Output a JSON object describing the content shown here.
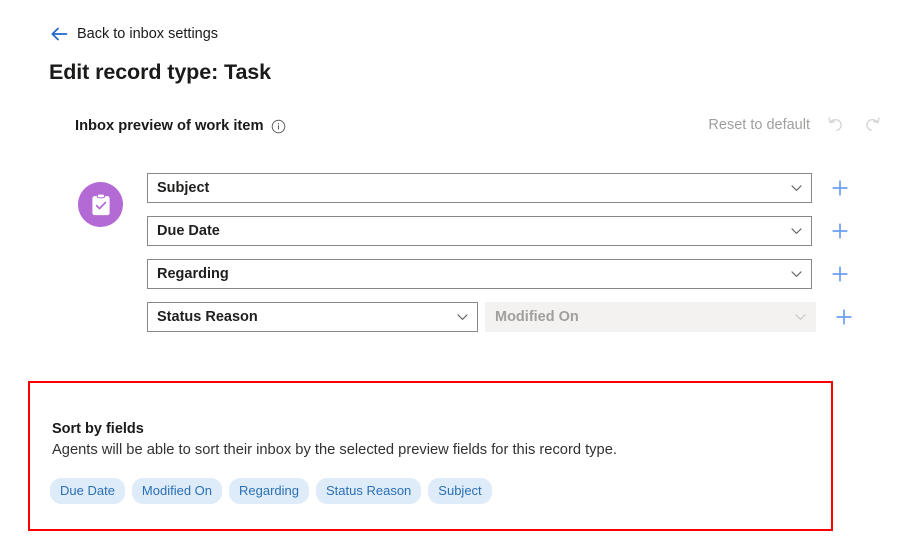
{
  "back": {
    "label": "Back to inbox settings",
    "icon": "arrow-left-icon"
  },
  "title": "Edit record type: Task",
  "preview": {
    "heading": "Inbox preview of work item",
    "info_icon": "info-icon",
    "reset_label": "Reset to default",
    "undo_icon": "undo-icon",
    "redo_icon": "redo-icon",
    "record_icon": "task-clipboard-icon",
    "add_icon": "plus-icon",
    "chevron_icon": "chevron-down-icon",
    "rows": [
      {
        "primary": "Subject",
        "secondary": null
      },
      {
        "primary": "Due Date",
        "secondary": null
      },
      {
        "primary": "Regarding",
        "secondary": null
      },
      {
        "primary": "Status Reason",
        "secondary": "Modified On"
      }
    ]
  },
  "sort": {
    "title": "Sort by fields",
    "description": "Agents will be able to sort their inbox by the selected preview fields for this record type.",
    "tags": [
      "Due Date",
      "Modified On",
      "Regarding",
      "Status Reason",
      "Subject"
    ],
    "highlight_color": "#ff0000"
  },
  "colors": {
    "link_blue": "#2266cc",
    "accent_purple": "#b36ad4",
    "tag_bg": "#deecf9",
    "tag_text": "#2b6fb5",
    "plus_blue": "#6b9ef0",
    "disabled_text": "#a19f9d"
  }
}
